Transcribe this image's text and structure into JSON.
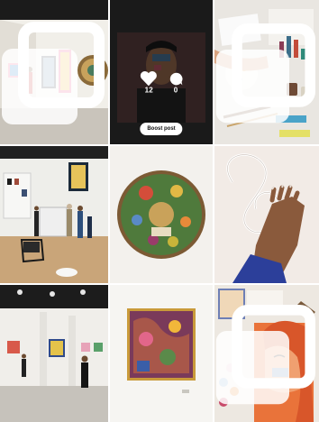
{
  "grid": {
    "hover_post": {
      "likes": "12",
      "comments": "0",
      "boost_label": "Boost post"
    },
    "icons": {
      "heart": "heart-icon",
      "comment": "comment-icon",
      "multi": "carousel-icon"
    }
  }
}
